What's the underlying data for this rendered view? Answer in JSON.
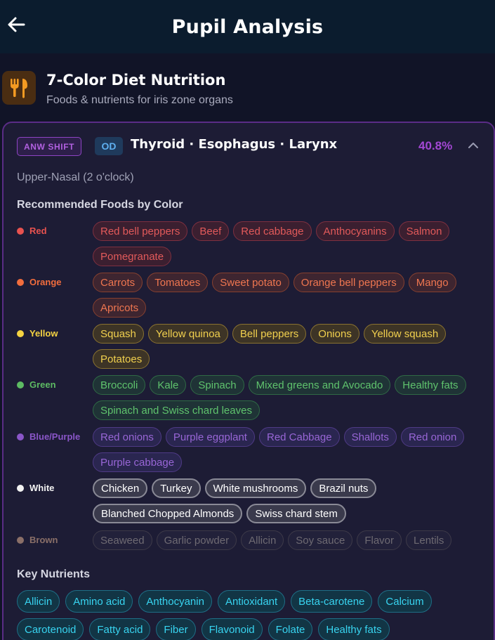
{
  "header": {
    "title": "Pupil Analysis",
    "back_icon": "arrow-left-icon"
  },
  "section": {
    "icon": "utensils-icon",
    "title": "7-Color Diet Nutrition",
    "subtitle": "Foods & nutrients for iris zone organs"
  },
  "card": {
    "shift_tag": "ANW SHIFT",
    "eye_tag": "OD",
    "title": "Thyroid · Esophagus · Larynx",
    "percent": "40.8%",
    "location": "Upper-Nasal (2 o'clock)",
    "foods_heading": "Recommended Foods by Color",
    "nutrients_heading": "Key Nutrients",
    "colors": {
      "red": {
        "label": "Red",
        "dot": "#e8524f",
        "foods": [
          "Red bell peppers",
          "Beef",
          "Red cabbage",
          "Anthocyanins",
          "Salmon",
          "Pomegranate"
        ]
      },
      "orange": {
        "label": "Orange",
        "dot": "#f26d3d",
        "foods": [
          "Carrots",
          "Tomatoes",
          "Sweet potato",
          "Orange bell peppers",
          "Mango",
          "Apricots"
        ]
      },
      "yellow": {
        "label": "Yellow",
        "dot": "#f5d342",
        "foods": [
          "Squash",
          "Yellow quinoa",
          "Bell peppers",
          "Onions",
          "Yellow squash",
          "Potatoes"
        ]
      },
      "green": {
        "label": "Green",
        "dot": "#5dbb63",
        "foods": [
          "Broccoli",
          "Kale",
          "Spinach",
          "Mixed greens and Avocado",
          "Healthy fats",
          "Spinach and Swiss chard leaves"
        ]
      },
      "purple": {
        "label": "Blue/Purple",
        "dot": "#8a56c8",
        "foods": [
          "Red onions",
          "Purple eggplant",
          "Red Cabbage",
          "Shallots",
          "Red onion",
          "Purple cabbage"
        ]
      },
      "white": {
        "label": "White",
        "dot": "#f2f2f2",
        "foods": [
          "Chicken",
          "Turkey",
          "White mushrooms",
          "Brazil nuts",
          "Blanched Chopped Almonds",
          "Swiss chard stem"
        ]
      },
      "brown": {
        "label": "Brown",
        "dot": "#8a6f68",
        "foods": [
          "Seaweed",
          "Garlic powder",
          "Allicin",
          "Soy sauce",
          "Flavor",
          "Lentils"
        ]
      }
    },
    "nutrients": [
      "Allicin",
      "Amino acid",
      "Anthocyanin",
      "Antioxidant",
      "Beta-carotene",
      "Calcium",
      "Carotenoid",
      "Fatty acid",
      "Fiber",
      "Flavonoid",
      "Folate",
      "Healthy fats"
    ]
  }
}
